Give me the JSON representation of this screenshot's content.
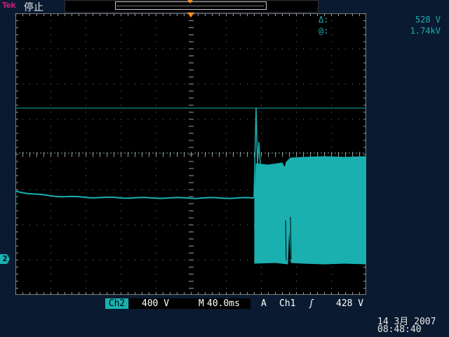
{
  "header": {
    "brand": "Tek",
    "status": "停止"
  },
  "cursor": {
    "delta_symbol": "Δ:",
    "delta_value": "528 V",
    "at_symbol": "@:",
    "at_value": "1.74kV"
  },
  "channel": {
    "marker": "2",
    "name": "Ch2",
    "scale": "400 V"
  },
  "timebase": {
    "label": "M",
    "value": "40.0ms"
  },
  "trigger": {
    "mode": "A",
    "source": "Ch1",
    "slope_symbol": "ʃ",
    "level": "428 V"
  },
  "datetime": {
    "date": "14 3月  2007",
    "time": "08:48:40"
  },
  "colors": {
    "trace": "#1ab0b0",
    "trigger_marker": "#ff8c1a",
    "brand": "#c0207a"
  }
}
